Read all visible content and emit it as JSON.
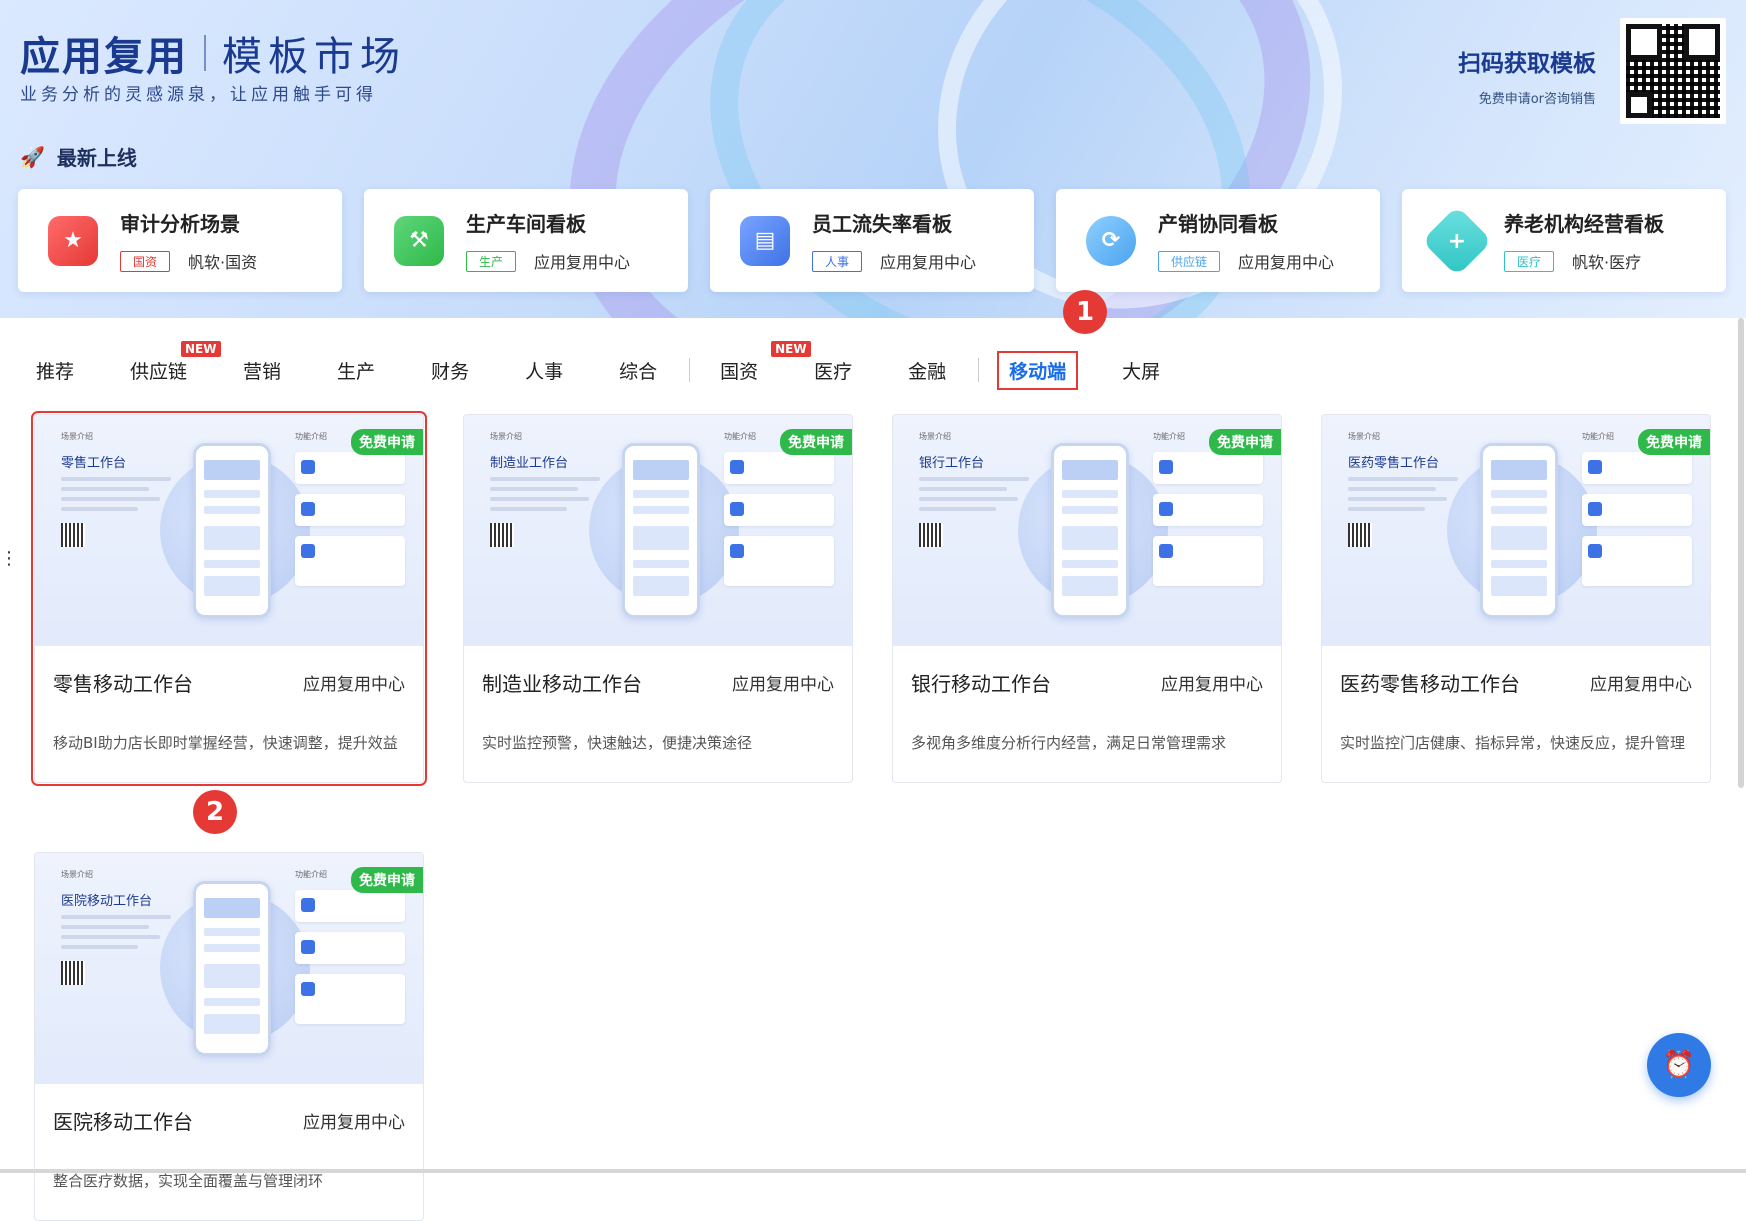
{
  "header": {
    "title": "应用复用",
    "subtitle": "模板市场",
    "slogan": "业务分析的灵感源泉，让应用触手可得",
    "scan_title": "扫码获取模板",
    "scan_sub": "免费申请or咨询销售"
  },
  "latest": {
    "label": "最新上线",
    "items": [
      {
        "title": "审计分析场景",
        "tag": "国资",
        "source": "帆软·国资",
        "color": "#e53935",
        "icon": "house-star-icon"
      },
      {
        "title": "生产车间看板",
        "tag": "生产",
        "source": "应用复用中心",
        "color": "#2fb94a",
        "icon": "house-wrench-icon"
      },
      {
        "title": "员工流失率看板",
        "tag": "人事",
        "source": "应用复用中心",
        "color": "#3d72e6",
        "icon": "id-card-icon"
      },
      {
        "title": "产销协同看板",
        "tag": "供应链",
        "source": "应用复用中心",
        "color": "#4aa3ef",
        "icon": "sync-icon"
      },
      {
        "title": "养老机构经营看板",
        "tag": "医疗",
        "source": "帆软·医疗",
        "color": "#2ec4c4",
        "icon": "medical-plus-icon"
      }
    ]
  },
  "tabs": [
    {
      "label": "推荐",
      "badge": ""
    },
    {
      "label": "供应链",
      "badge": "NEW"
    },
    {
      "label": "营销",
      "badge": ""
    },
    {
      "label": "生产",
      "badge": ""
    },
    {
      "label": "财务",
      "badge": ""
    },
    {
      "label": "人事",
      "badge": ""
    },
    {
      "label": "综合",
      "badge": ""
    },
    {
      "label": "国资",
      "badge": "NEW"
    },
    {
      "label": "医疗",
      "badge": ""
    },
    {
      "label": "金融",
      "badge": ""
    },
    {
      "label": "移动端",
      "badge": ""
    },
    {
      "label": "大屏",
      "badge": ""
    }
  ],
  "active_tab": "移动端",
  "steps": [
    "1",
    "2"
  ],
  "free_label": "免费申请",
  "cards": [
    {
      "title": "零售移动工作台",
      "source": "应用复用中心",
      "desc": "移动BI助力店长即时掌握经营，快速调整，提升效益",
      "thumb_title": "零售工作台"
    },
    {
      "title": "制造业移动工作台",
      "source": "应用复用中心",
      "desc": "实时监控预警，快速触达，便捷决策途径",
      "thumb_title": "制造业工作台"
    },
    {
      "title": "银行移动工作台",
      "source": "应用复用中心",
      "desc": "多视角多维度分析行内经营，满足日常管理需求",
      "thumb_title": "银行工作台"
    },
    {
      "title": "医药零售移动工作台",
      "source": "应用复用中心",
      "desc": "实时监控门店健康、指标异常，快速反应，提升管理",
      "thumb_title": "医药零售工作台"
    },
    {
      "title": "医院移动工作台",
      "source": "应用复用中心",
      "desc": "整合医疗数据，实现全面覆盖与管理闭环",
      "thumb_title": "医院移动工作台"
    }
  ],
  "thumb_labels": {
    "left": "场景介绍",
    "right": "功能介绍"
  }
}
